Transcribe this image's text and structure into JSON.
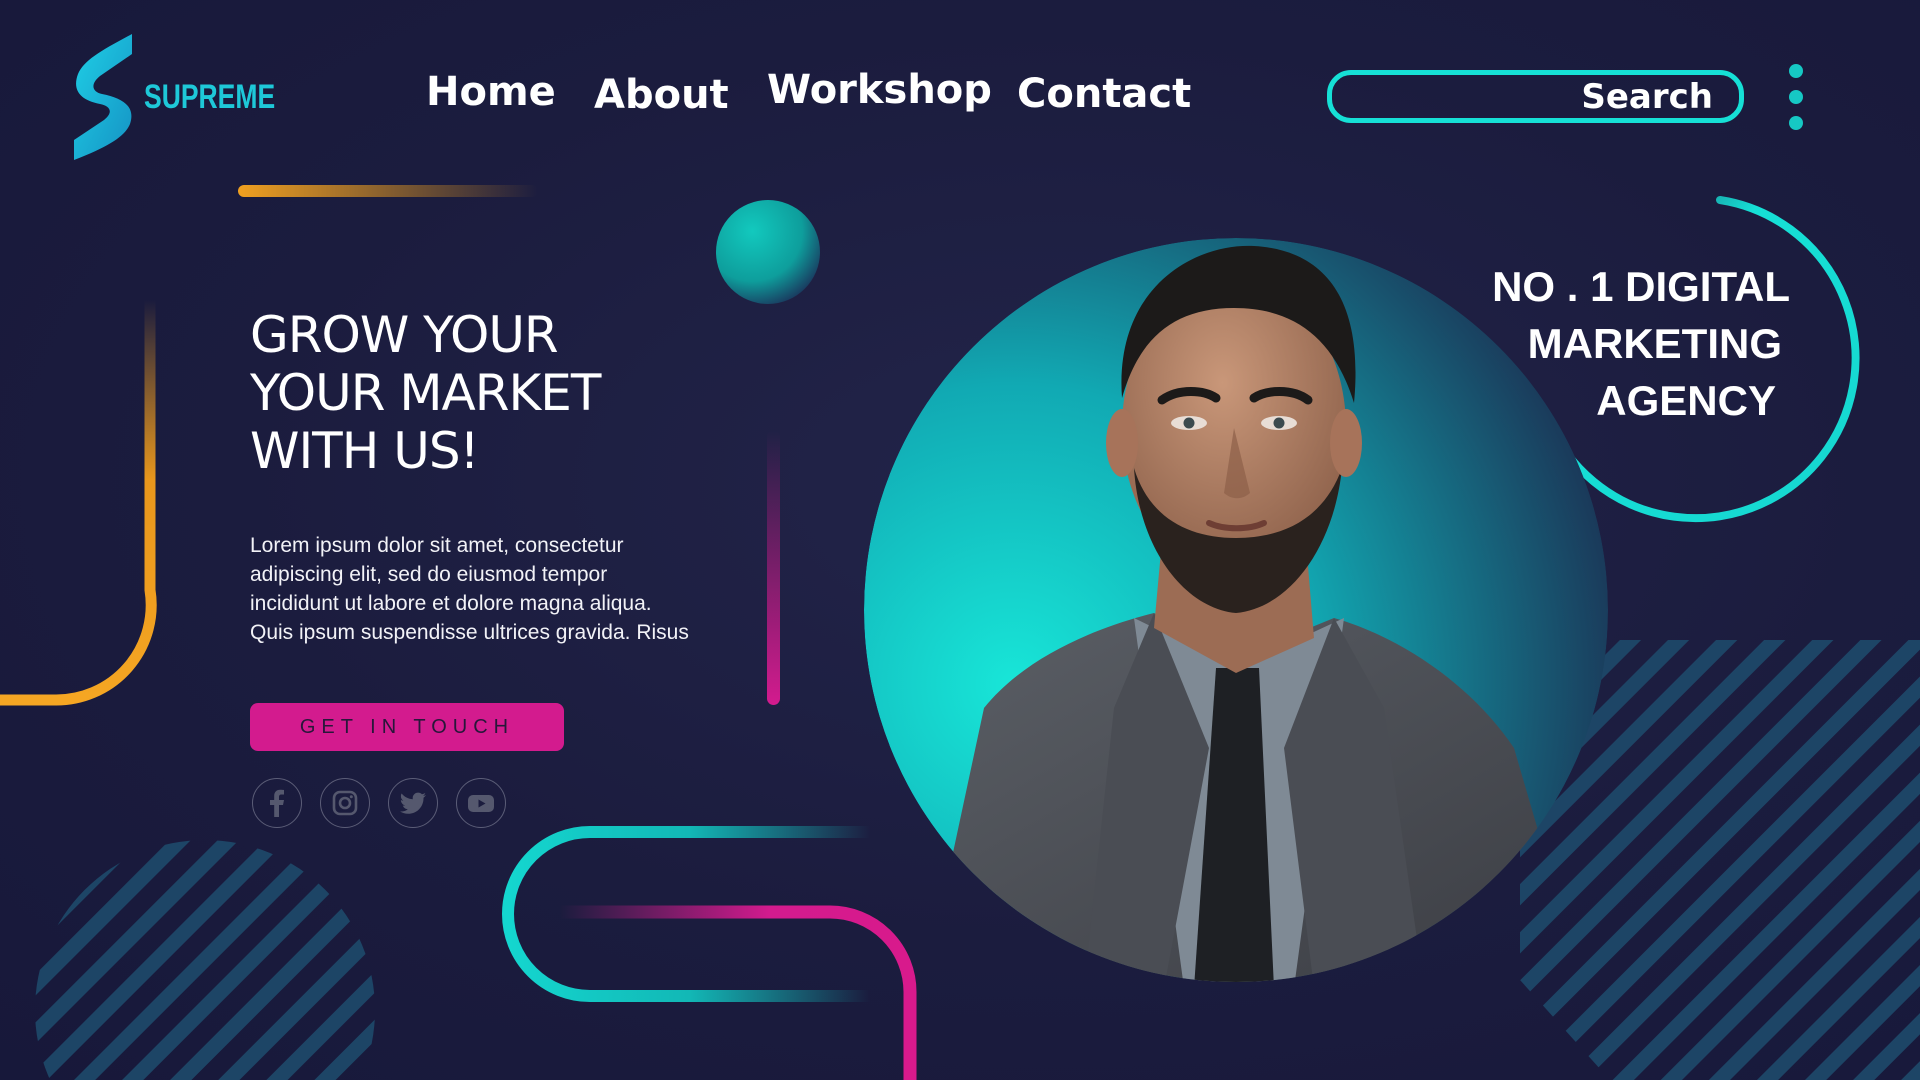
{
  "brand": {
    "name": "SUPREME",
    "accent": "#1ec8d8",
    "logo_icon": "s-logo-icon"
  },
  "nav": {
    "items": [
      {
        "label": "Home"
      },
      {
        "label": "About"
      },
      {
        "label": "Workshop"
      },
      {
        "label": "Contact"
      }
    ]
  },
  "search": {
    "label": "Search",
    "border_color": "#16e0d6"
  },
  "menu": {
    "icon": "kebab-menu-icon"
  },
  "hero": {
    "title_lines": [
      "GROW YOUR",
      "YOUR MARKET",
      "WITH US!"
    ],
    "body_lines": [
      "Lorem ipsum dolor sit amet, consectetur",
      "adipiscing elit, sed do eiusmod tempor",
      "incididunt ut labore et dolore magna aliqua.",
      "Quis ipsum suspendisse ultrices gravida. Risus"
    ],
    "cta_label": "GET IN TOUCH",
    "cta_color": "#d31b8e"
  },
  "socials": [
    {
      "icon": "facebook-icon"
    },
    {
      "icon": "instagram-icon"
    },
    {
      "icon": "twitter-icon"
    },
    {
      "icon": "youtube-icon"
    }
  ],
  "agency": {
    "lines": [
      "NO . 1 DIGITAL",
      "MARKETING",
      "AGENCY"
    ]
  },
  "colors": {
    "background": "#1b1c3e",
    "teal": "#16e0d6",
    "orange": "#f0a020",
    "magenta": "#d31b8e"
  }
}
